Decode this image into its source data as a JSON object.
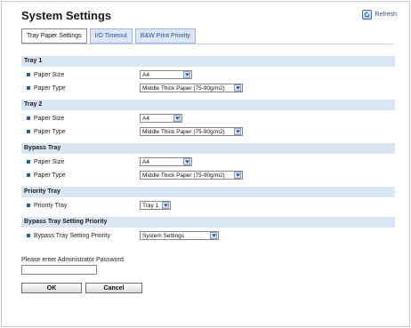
{
  "header": {
    "title": "System Settings",
    "refresh_label": "Refresh",
    "refresh_icon": "refresh-icon"
  },
  "tabs": [
    {
      "label": "Tray Paper Settings",
      "active": true
    },
    {
      "label": "I/O Timeout",
      "active": false
    },
    {
      "label": "B&W Print Priority",
      "active": false
    }
  ],
  "sections": {
    "tray1": {
      "title": "Tray 1",
      "paper_size_label": "Paper Size",
      "paper_size_value": "A4",
      "paper_type_label": "Paper Type",
      "paper_type_value": "Middle Thick Paper (75-90g/m2)"
    },
    "tray2": {
      "title": "Tray 2",
      "paper_size_label": "Paper Size",
      "paper_size_value": "A4",
      "paper_type_label": "Paper Type",
      "paper_type_value": "Middle Thick Paper (75-90g/m2)"
    },
    "bypass": {
      "title": "Bypass Tray",
      "paper_size_label": "Paper Size",
      "paper_size_value": "A4",
      "paper_type_label": "Paper Type",
      "paper_type_value": "Middle Thick Paper (75-90g/m2)"
    },
    "priority": {
      "title": "Priority Tray",
      "label": "Priority Tray",
      "value": "Tray 1"
    },
    "bypass_priority": {
      "title": "Bypass Tray Setting Priority",
      "label": "Bypass Tray Setting Priority",
      "value": "System Settings"
    }
  },
  "password": {
    "label": "Please enter Administrator Password.",
    "value": ""
  },
  "buttons": {
    "ok": "OK",
    "cancel": "Cancel"
  },
  "colors": {
    "section_header_bg": "#dbe6f5",
    "bullet": "#2c5aa0",
    "link": "#1d4f9e"
  }
}
